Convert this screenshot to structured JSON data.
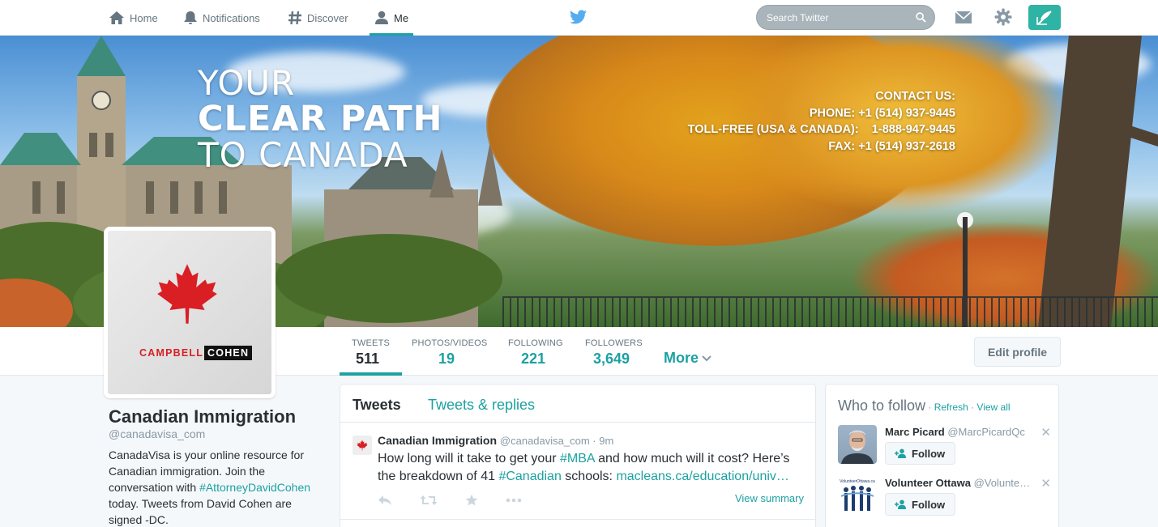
{
  "nav": {
    "items": [
      {
        "label": "Home",
        "icon": "home-icon"
      },
      {
        "label": "Notifications",
        "icon": "bell-icon"
      },
      {
        "label": "Discover",
        "icon": "hashtag-icon"
      },
      {
        "label": "Me",
        "icon": "person-icon"
      }
    ],
    "active": "Me",
    "search_placeholder": "Search Twitter",
    "accent": "#1da1a2"
  },
  "banner": {
    "headline_1": "YOUR",
    "headline_2": "CLEAR PATH",
    "headline_3": "TO CANADA",
    "contact_title": "CONTACT US:",
    "phone": "PHONE: +1 (514) 937-9445",
    "tollfree": "TOLL-FREE (USA & CANADA):    1-888-947-9445",
    "fax": "FAX: +1 (514) 937-2618"
  },
  "avatar": {
    "brand_red": "CAMPBELL",
    "brand_black": "COHEN"
  },
  "stats": [
    {
      "label": "TWEETS",
      "value": "511"
    },
    {
      "label": "PHOTOS/VIDEOS",
      "value": "19"
    },
    {
      "label": "FOLLOWING",
      "value": "221"
    },
    {
      "label": "FOLLOWERS",
      "value": "3,649"
    }
  ],
  "more_label": "More",
  "edit_profile_label": "Edit profile",
  "profile": {
    "name": "Canadian Immigration",
    "handle": "@canadavisa_com",
    "bio_1": "CanadaVisa is your online resource for Canadian immigration. Join the conversation with ",
    "bio_link": "#AttorneyDavidCohen",
    "bio_2": " today. Tweets from David Cohen are signed -DC."
  },
  "timeline": {
    "tab_tweets": "Tweets",
    "tab_replies": "Tweets & replies",
    "tweet": {
      "name": "Canadian Immigration",
      "handle": "@canadavisa_com",
      "time": " · 9m",
      "text_1": "How long will it take to get your ",
      "hashtag_1": "#MBA",
      "text_2": " and how much will it cost? Here’s the breakdown of 41 ",
      "hashtag_2": "#Canadian",
      "text_3": " schools:  ",
      "link": "macleans.ca/education/univ…",
      "view_summary": "View summary"
    }
  },
  "who_to_follow": {
    "title": "Who to follow",
    "sep": " · ",
    "refresh": "Refresh",
    "view_all": "View all",
    "follow_label": "Follow",
    "close_glyph": "✕",
    "users": [
      {
        "name": "Marc Picard",
        "handle": "@MarcPicardQc"
      },
      {
        "name": "Volunteer Ottawa",
        "handle": "@Volunte…",
        "logo_text": "VolunteerOttawa.ca"
      }
    ]
  }
}
